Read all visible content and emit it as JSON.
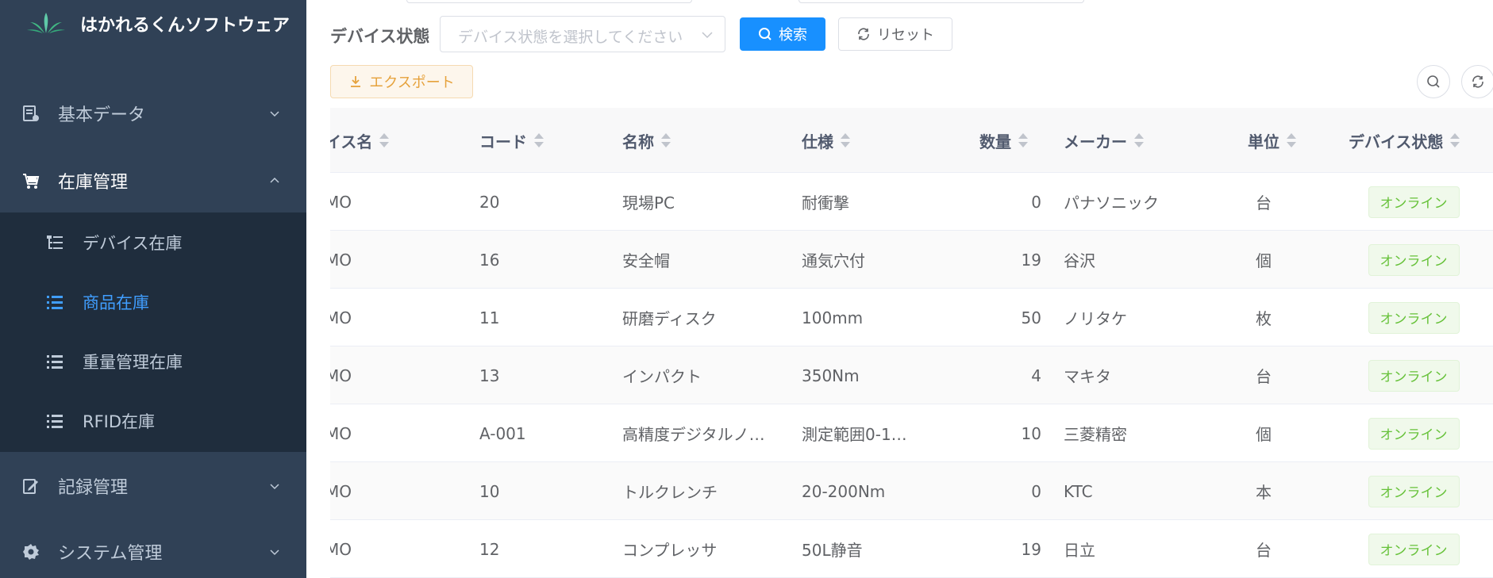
{
  "app": {
    "title": "はかれるくんソフトウェア"
  },
  "sidebar": {
    "menus": [
      {
        "label": "基本データ",
        "icon": "database-icon",
        "open": false
      },
      {
        "label": "在庫管理",
        "icon": "cart-icon",
        "open": true
      },
      {
        "label": "記録管理",
        "icon": "edit-icon",
        "open": false
      },
      {
        "label": "システム管理",
        "icon": "gear-icon",
        "open": false
      }
    ],
    "submenu": [
      {
        "label": "デバイス在庫",
        "icon": "tree-list-icon",
        "active": false
      },
      {
        "label": "商品在庫",
        "icon": "list-icon",
        "active": true
      },
      {
        "label": "重量管理在庫",
        "icon": "list-icon",
        "active": false
      },
      {
        "label": "RFID在庫",
        "icon": "list-icon",
        "active": false
      }
    ]
  },
  "filter": {
    "label": "デバイス状態",
    "placeholder": "デバイス状態を選択してください",
    "search_label": "検索",
    "reset_label": "リセット"
  },
  "toolbar": {
    "export_label": "エクスポート"
  },
  "table": {
    "headers": [
      "イス名",
      "コード",
      "名称",
      "仕様",
      "数量",
      "メーカー",
      "単位",
      "デバイス状態"
    ],
    "rows": [
      [
        "MO",
        "20",
        "現場PC",
        "耐衝撃",
        "0",
        "パナソニック",
        "台",
        "オンライン"
      ],
      [
        "MO",
        "16",
        "安全帽",
        "通気穴付",
        "19",
        "谷沢",
        "個",
        "オンライン"
      ],
      [
        "MO",
        "11",
        "研磨ディスク",
        "100mm",
        "50",
        "ノリタケ",
        "枚",
        "オンライン"
      ],
      [
        "MO",
        "13",
        "インパクト",
        "350Nm",
        "4",
        "マキタ",
        "台",
        "オンライン"
      ],
      [
        "MO",
        "A-001",
        "高精度デジタルノ…",
        "測定範囲0-1…",
        "10",
        "三菱精密",
        "個",
        "オンライン"
      ],
      [
        "MO",
        "10",
        "トルクレンチ",
        "20-200Nm",
        "0",
        "KTC",
        "本",
        "オンライン"
      ],
      [
        "MO",
        "12",
        "コンプレッサ",
        "50L静音",
        "19",
        "日立",
        "台",
        "オンライン"
      ]
    ]
  },
  "colors": {
    "sidebar": "#304156",
    "submenu": "#1f2d3d",
    "accent": "#1890ff",
    "success": "#67c23a",
    "warning": "#e6a23c"
  }
}
